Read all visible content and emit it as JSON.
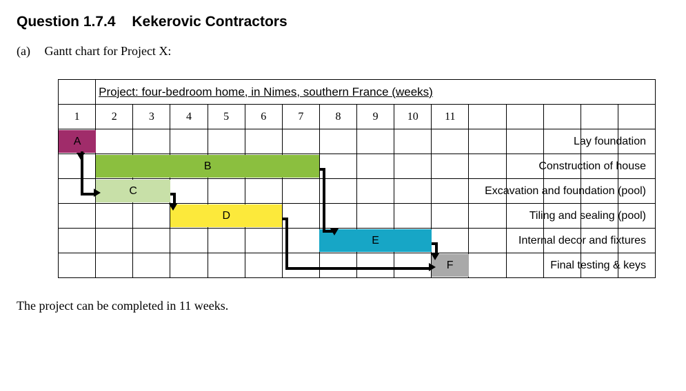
{
  "heading": {
    "number": "Question 1.7.4",
    "title": "Kekerovic Contractors"
  },
  "part": {
    "label": "(a)",
    "text": "Gantt chart for Project X:"
  },
  "chart_data": {
    "type": "gantt",
    "title": "Project: four-bedroom home, in Nimes, southern France (weeks)",
    "weeks": [
      "1",
      "2",
      "3",
      "4",
      "5",
      "6",
      "7",
      "8",
      "9",
      "10",
      "11"
    ],
    "total_weeks_shown": 16,
    "tasks": [
      {
        "id": "A",
        "label": "Lay foundation",
        "start": 1,
        "end": 1,
        "color": "#a02c6a"
      },
      {
        "id": "B",
        "label": "Construction of house",
        "start": 2,
        "end": 7,
        "color": "#8bbf3f"
      },
      {
        "id": "C",
        "label": "Excavation and foundation (pool)",
        "start": 2,
        "end": 3,
        "color": "#c8e0a8"
      },
      {
        "id": "D",
        "label": "Tiling and sealing (pool)",
        "start": 4,
        "end": 6,
        "color": "#fce93b"
      },
      {
        "id": "E",
        "label": "Internal decor and fixtures",
        "start": 8,
        "end": 10,
        "color": "#17a6c6"
      },
      {
        "id": "F",
        "label": "Final testing & keys",
        "start": 11,
        "end": 11,
        "color": "#a9a9a9"
      }
    ],
    "dependencies": [
      {
        "from": "A",
        "to": "B"
      },
      {
        "from": "A",
        "to": "C"
      },
      {
        "from": "C",
        "to": "D"
      },
      {
        "from": "B",
        "to": "E"
      },
      {
        "from": "D",
        "to": "F"
      },
      {
        "from": "E",
        "to": "F"
      }
    ]
  },
  "footer": "The project can be completed in 11 weeks."
}
